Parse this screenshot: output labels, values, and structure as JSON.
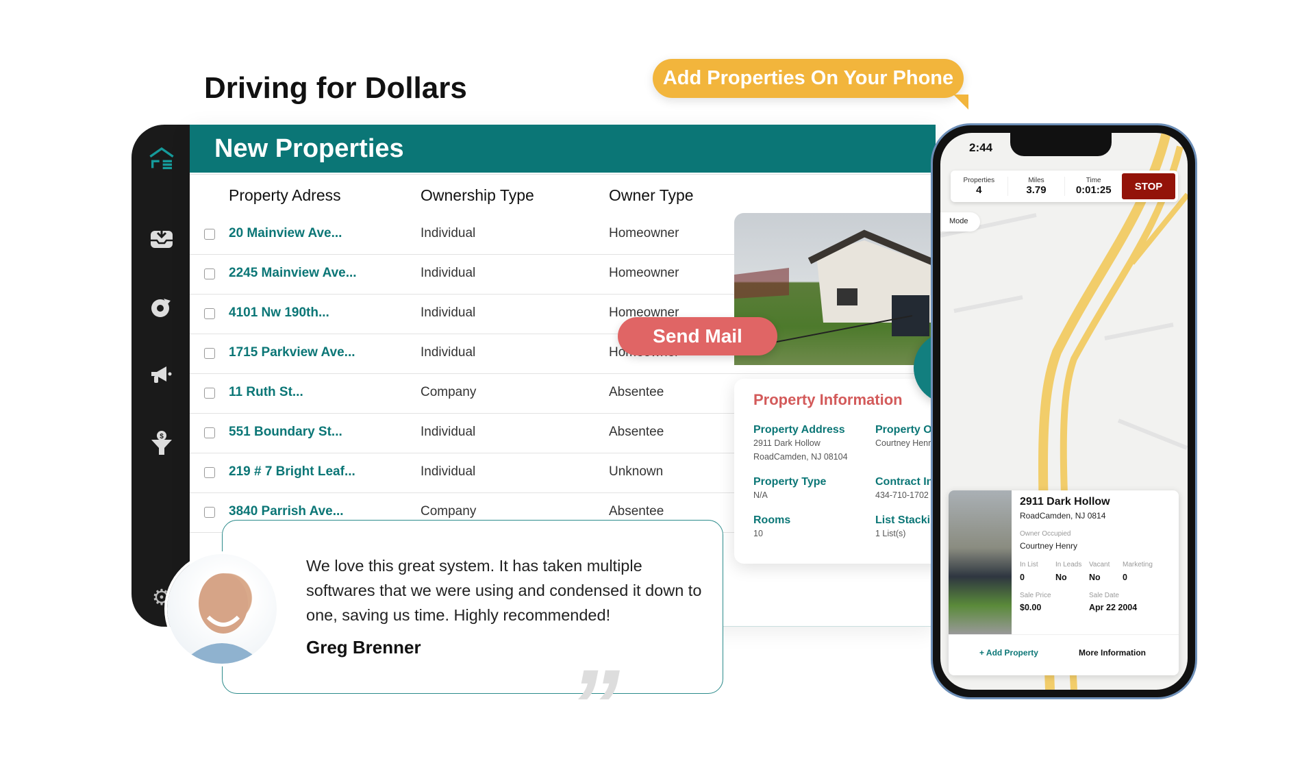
{
  "page_title": "Driving for Dollars",
  "callout": "Add Properties On Your Phone",
  "sidebar": {
    "icons": [
      "logo-icon",
      "inbox-download-icon",
      "pie-chart-icon",
      "megaphone-icon",
      "dollar-funnel-icon",
      "gear-icon"
    ]
  },
  "panel": {
    "title": "New Properties",
    "columns": [
      "Property Adress",
      "Ownership Type",
      "Owner Type"
    ],
    "rows": [
      {
        "address": "20 Mainview Ave...",
        "ownership": "Individual",
        "owner": "Homeowner"
      },
      {
        "address": "2245 Mainview Ave...",
        "ownership": "Individual",
        "owner": "Homeowner"
      },
      {
        "address": "4101 Nw 190th...",
        "ownership": "Individual",
        "owner": "Homeowner"
      },
      {
        "address": "1715 Parkview Ave...",
        "ownership": "Individual",
        "owner": "Homeowner"
      },
      {
        "address": "11 Ruth St...",
        "ownership": "Company",
        "owner": "Absentee"
      },
      {
        "address": "551 Boundary St...",
        "ownership": "Individual",
        "owner": "Absentee"
      },
      {
        "address": "219 # 7 Bright Leaf...",
        "ownership": "Individual",
        "owner": "Unknown"
      },
      {
        "address": "3840 Parrish Ave...",
        "ownership": "Company",
        "owner": "Absentee"
      }
    ]
  },
  "send_mail": "Send Mail",
  "property_info": {
    "title": "Property Information",
    "fields": [
      {
        "label": "Property Address",
        "value": "2911 Dark Hollow RoadCamden, NJ 08104"
      },
      {
        "label": "Property  Owner",
        "value": "Courtney Henry"
      },
      {
        "label": "Property Type",
        "value": "N/A"
      },
      {
        "label": "Contract Info",
        "value": "434-710-1702"
      },
      {
        "label": "Rooms",
        "value": "10"
      },
      {
        "label": "List Stacking",
        "value": "1 List(s)"
      }
    ]
  },
  "phone": {
    "time": "2:44",
    "stats": [
      {
        "label": "Properties",
        "value": "4"
      },
      {
        "label": "Miles",
        "value": "3.79"
      },
      {
        "label": "Time",
        "value": "0:01:25"
      }
    ],
    "stop": "STOP",
    "mode": "Mode",
    "card": {
      "title": "2911 Dark Hollow",
      "subtitle": "RoadCamden, NJ 0814",
      "owner_label": "Owner Occupied",
      "owner": "Courtney Henry",
      "grid": [
        {
          "label": "In List",
          "value": "0"
        },
        {
          "label": "In Leads",
          "value": "No"
        },
        {
          "label": "Vacant",
          "value": "No"
        },
        {
          "label": "Marketing",
          "value": "0"
        }
      ],
      "sale_price_label": "Sale Price",
      "sale_price": "$0.00",
      "sale_date_label": "Sale Date",
      "sale_date": "Apr 22 2004",
      "add_property": "+ Add Property",
      "more_info": "More Information"
    }
  },
  "testimonial": {
    "quote": "We love this great system. It has taken multiple softwares that we were using and condensed it down to one, saving us time. Highly recommended!",
    "name": "Greg Brenner"
  },
  "colors": {
    "teal": "#0b7676",
    "orange": "#f2b53c",
    "coral": "#e06565",
    "stop_red": "#931309",
    "sidebar": "#1a1a1a"
  }
}
